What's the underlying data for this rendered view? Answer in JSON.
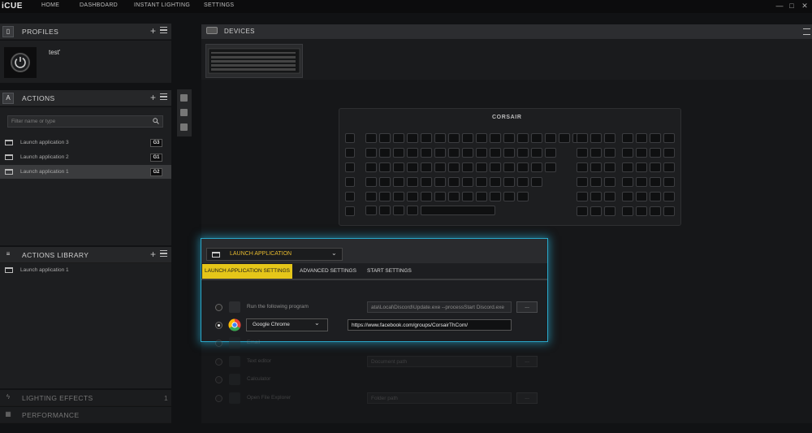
{
  "app": {
    "logo": "iCUE"
  },
  "nav": {
    "home": "HOME",
    "dashboard": "DASHBOARD",
    "instant_lighting": "INSTANT LIGHTING",
    "settings": "SETTINGS"
  },
  "window": {
    "minimize": "—",
    "maximize": "□",
    "close": "✕"
  },
  "profiles": {
    "title": "PROFILES",
    "profile_name": "test'"
  },
  "actions": {
    "title": "ACTIONS",
    "search_placeholder": "Filter name or type",
    "items": [
      {
        "label": "Launch application 3",
        "key": "G3"
      },
      {
        "label": "Launch application 2",
        "key": "G1"
      },
      {
        "label": "Launch application 1",
        "key": "G2"
      }
    ]
  },
  "actions_library": {
    "title": "ACTIONS LIBRARY",
    "items": [
      {
        "label": "Launch application 1"
      }
    ]
  },
  "lighting_effects": {
    "title": "LIGHTING EFFECTS",
    "count": "1"
  },
  "performance": {
    "title": "PERFORMANCE"
  },
  "devices": {
    "title": "DEVICES",
    "brand": "CORSAIR"
  },
  "launch": {
    "dropdown_label": "LAUNCH APPLICATION",
    "tabs": [
      "LAUNCH APPLICATION SETTINGS",
      "ADVANCED SETTINGS",
      "START SETTINGS"
    ],
    "run_program_label": "Run the following program",
    "run_program_value": "ata\\Local\\Discord\\Update.exe --processStart Discord.exe",
    "browser_select": "Google Chrome",
    "browser_url": "https://www.facebook.com/groups/CorsairThCom/",
    "email_label": "Email",
    "text_editor_label": "Text editor",
    "text_editor_placeholder": "Document path",
    "calculator_label": "Calculator",
    "file_explorer_label": "Open File Explorer",
    "file_explorer_placeholder": "Folder path",
    "browse": "..."
  },
  "colors": {
    "accent": "#e5c619",
    "highlight": "#2aa7c9"
  }
}
